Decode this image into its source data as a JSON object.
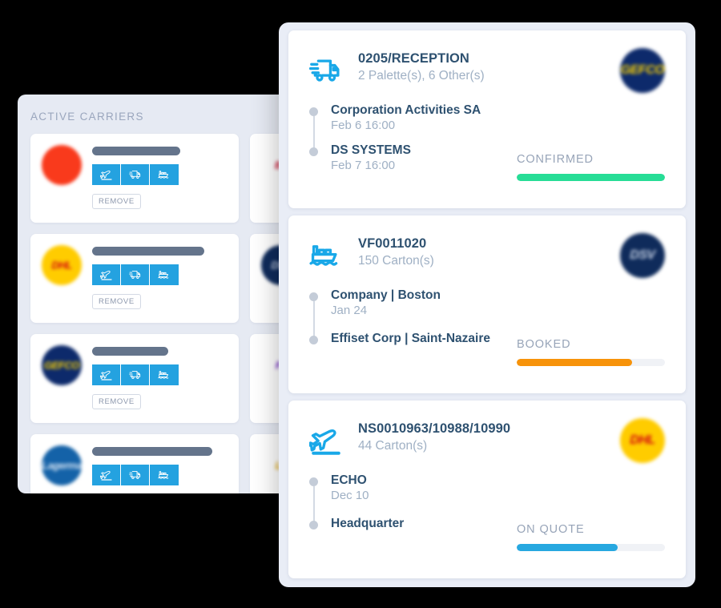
{
  "carriers_panel": {
    "title": "ACTIVE CARRIERS",
    "remove_label": "REMOVE",
    "mode_icons": [
      "plane-icon",
      "truck-icon",
      "ship-icon"
    ],
    "cards": [
      {
        "logo_name": "carrier-logo-red",
        "logo_bg": "#f93a1c",
        "logo_text": "",
        "logo_color": "#f93a1c",
        "name_bar_width": 110,
        "show_remove": true
      },
      {
        "logo_name": "carrier-logo-bollore",
        "logo_bg": "#ffffff",
        "logo_text": "BL",
        "logo_color": "#c8102e",
        "name_bar_width": 110,
        "show_remove": true
      },
      {
        "logo_name": "carrier-logo-dhl",
        "logo_bg": "#ffcc00",
        "logo_text": "DHL",
        "logo_color": "#d40511",
        "name_bar_width": 140,
        "show_remove": true
      },
      {
        "logo_name": "carrier-logo-dsv",
        "logo_bg": "#0f2b5b",
        "logo_text": "DSV",
        "logo_color": "#c9d4e6",
        "name_bar_width": 110,
        "show_remove": true
      },
      {
        "logo_name": "carrier-logo-gefco",
        "logo_bg": "#0d2a6b",
        "logo_text": "GEFCO",
        "logo_color": "#ffd400",
        "name_bar_width": 95,
        "show_remove": true
      },
      {
        "logo_name": "carrier-logo-fedex",
        "logo_bg": "#ffffff",
        "logo_text": "Fx",
        "logo_color": "#6a1cc4",
        "name_bar_width": 110,
        "show_remove": true
      },
      {
        "logo_name": "carrier-logo-lagermax",
        "logo_bg": "#1462a8",
        "logo_text": "Lagermax",
        "logo_color": "#d6e4f3",
        "name_bar_width": 150,
        "show_remove": false
      },
      {
        "logo_name": "carrier-logo-lufthansa",
        "logo_bg": "#ffffff",
        "logo_text": "Lu",
        "logo_color": "#e2a400",
        "name_bar_width": 110,
        "show_remove": false
      }
    ]
  },
  "shipments_panel": {
    "cards": [
      {
        "mode_icon": "truck-icon",
        "reference": "0205/RECEPTION",
        "quantity": "2 Palette(s), 6 Other(s)",
        "carrier_logo_name": "carrier-logo-gefco",
        "carrier_logo_bg": "#0d2a6b",
        "carrier_logo_text": "GEFCO",
        "carrier_logo_color": "#ffd400",
        "origin": "Corporation Activities SA",
        "origin_date": "Feb 6 16:00",
        "destination": "DS SYSTEMS",
        "destination_date": "Feb 7 16:00",
        "status_label": "CONFIRMED",
        "status_color": "#27dd96",
        "status_percent": 100
      },
      {
        "mode_icon": "ship-icon",
        "reference": "VF0011020",
        "quantity": "150 Carton(s)",
        "carrier_logo_name": "carrier-logo-dsv",
        "carrier_logo_bg": "#0f2b5b",
        "carrier_logo_text": "DSV",
        "carrier_logo_color": "#c9d4e6",
        "origin": "Company | Boston",
        "origin_date": "Jan 24",
        "destination": "Effiset Corp | Saint-Nazaire",
        "destination_date": "",
        "status_label": "BOOKED",
        "status_color": "#f7930a",
        "status_percent": 78
      },
      {
        "mode_icon": "plane-icon",
        "reference": "NS0010963/10988/10990",
        "quantity": "44 Carton(s)",
        "carrier_logo_name": "carrier-logo-dhl",
        "carrier_logo_bg": "#ffcc00",
        "carrier_logo_text": "DHL",
        "carrier_logo_color": "#d40511",
        "origin": "ECHO",
        "origin_date": "Dec 10",
        "destination": "Headquarter",
        "destination_date": "",
        "status_label": "ON QUOTE",
        "status_color": "#27a8e0",
        "status_percent": 68
      }
    ]
  },
  "colors": {
    "accent_blue": "#24a2e0",
    "panel_bg": "#e9edf6",
    "card_bg": "#ffffff",
    "title_text": "#2e5170",
    "muted_text": "#9fb0c4",
    "page_bg": "#000000"
  }
}
